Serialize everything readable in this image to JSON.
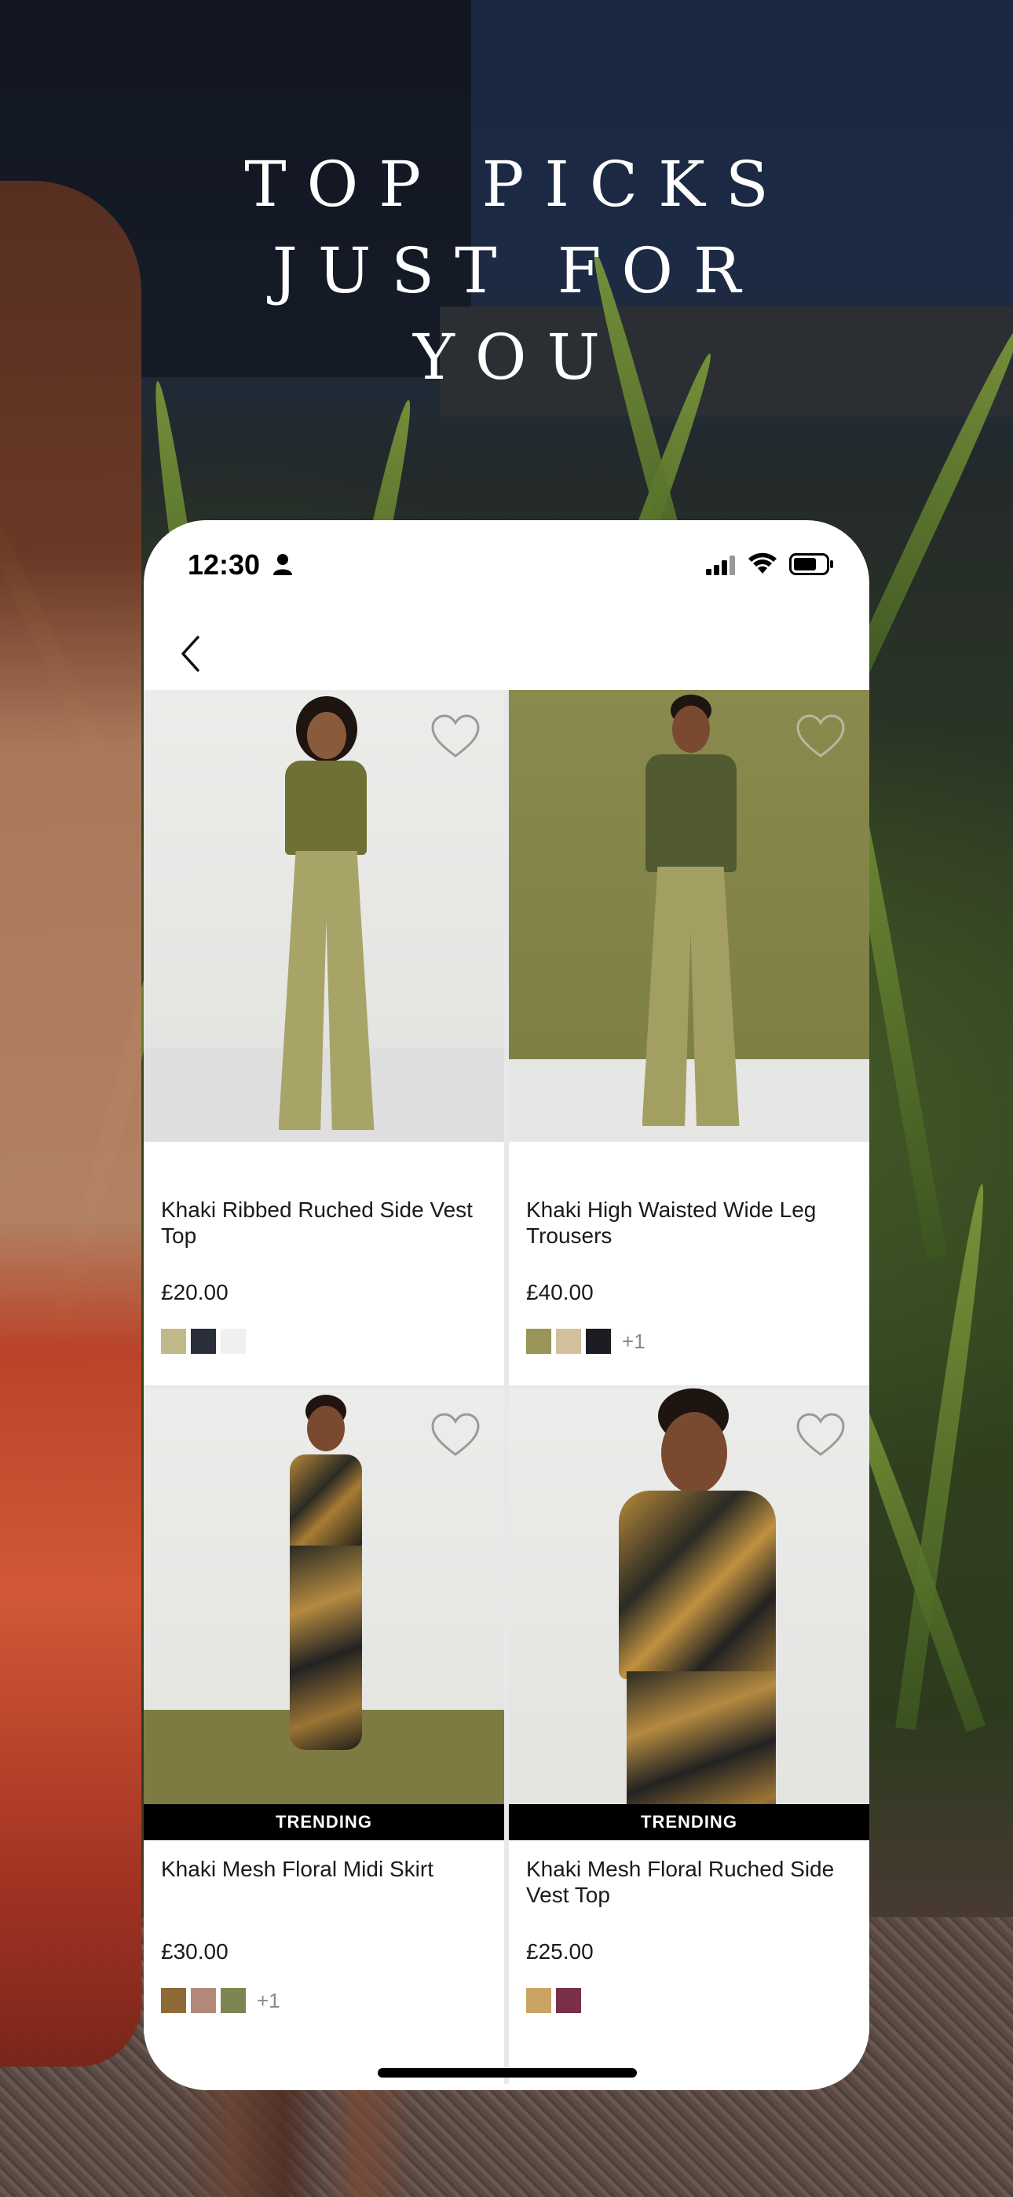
{
  "headline": {
    "line1": "TOP PICKS",
    "line2": "JUST FOR",
    "line3": "YOU"
  },
  "status_bar": {
    "time": "12:30"
  },
  "nav": {
    "back_icon": "chevron-left-icon"
  },
  "products": [
    {
      "name": "Khaki Ribbed Ruched Side Vest Top",
      "price": "£20.00",
      "badge": "",
      "swatches": [
        "#c2b98a",
        "#2a2d3a",
        "#f0f0f0"
      ],
      "more": ""
    },
    {
      "name": "Khaki High Waisted Wide Leg Trousers",
      "price": "£40.00",
      "badge": "",
      "swatches": [
        "#9a9556",
        "#d3bf9a",
        "#1c1d22"
      ],
      "more": "+1"
    },
    {
      "name": "Khaki Mesh Floral Midi Skirt",
      "price": "£30.00",
      "badge": "TRENDING",
      "swatches": [
        "#8f6a36",
        "#b38a7a",
        "#7d8550"
      ],
      "more": "+1"
    },
    {
      "name": "Khaki Mesh Floral Ruched Side Vest Top",
      "price": "£25.00",
      "badge": "TRENDING",
      "swatches": [
        "#c9a465",
        "#7a2f48"
      ],
      "more": ""
    }
  ],
  "colors": {
    "accent_text": "#1a1a1a",
    "badge_bg": "#000000",
    "phone_bg": "#ffffff"
  }
}
